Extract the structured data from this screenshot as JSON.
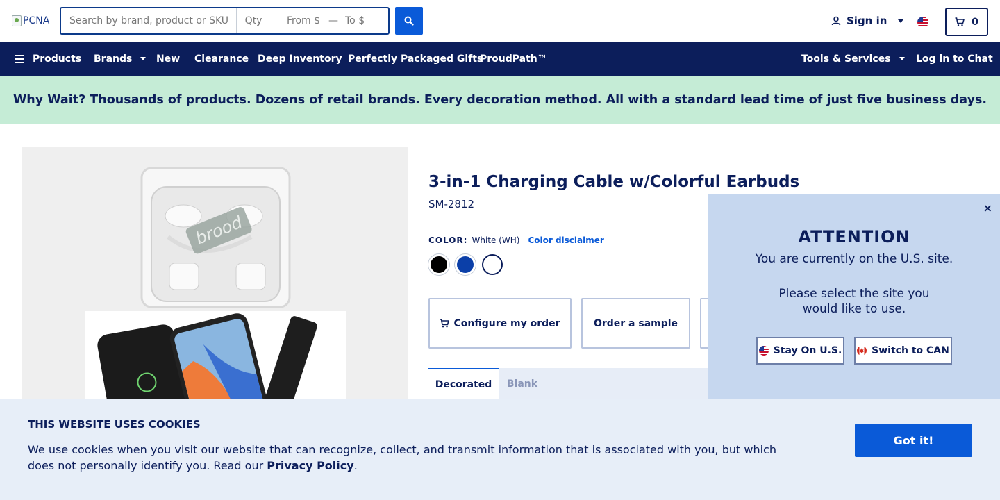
{
  "header": {
    "logo_alt": "PCNA",
    "search": {
      "placeholder": "Search by brand, product or SKU",
      "value": ""
    },
    "qty": {
      "placeholder": "Qty",
      "value": ""
    },
    "price_from": {
      "placeholder": "From $",
      "value": ""
    },
    "price_to": {
      "placeholder": "To $",
      "value": ""
    },
    "price_separator": "—",
    "signin_label": "Sign in",
    "cart_count": "0"
  },
  "nav": {
    "products": "Products",
    "brands": "Brands",
    "new": "New",
    "clearance": "Clearance",
    "deep_inventory": "Deep Inventory",
    "gifts": "Perfectly Packaged Gifts",
    "proudpath": "ProudPath™",
    "tools": "Tools & Services",
    "chat": "Log in to Chat"
  },
  "promo": {
    "text": "Why Wait? Thousands of products. Dozens of retail brands. Every decoration method. All with a standard lead time of just five business days."
  },
  "product": {
    "title": "3-in-1 Charging Cable w/Colorful Earbuds",
    "sku": "SM-2812",
    "image_logo_text": "brood",
    "color_label": "COLOR:",
    "color_value": "White (WH)",
    "color_disclaimer": "Color disclaimer",
    "swatches": [
      {
        "name": "Black",
        "hex": "#000000"
      },
      {
        "name": "Royal Blue",
        "hex": "#0b3fa8"
      },
      {
        "name": "White",
        "hex": "#ffffff"
      }
    ],
    "actions": {
      "configure": "Configure my order",
      "sample": "Order a sample"
    },
    "tabs": {
      "decorated": "Decorated",
      "blank": "Blank"
    }
  },
  "attention": {
    "close": "×",
    "title": "ATTENTION",
    "message1": "You are currently on the U.S. site.",
    "message2": "Please select the site you would like to use.",
    "stay_label": "Stay On U.S.",
    "switch_label": "Switch to CAN"
  },
  "cookies": {
    "title": "THIS WEBSITE USES COOKIES",
    "text": "We use cookies when you visit our website that can recognize, collect, and transmit information that is associated with you, but which does not personally identify you. Read our ",
    "link": "Privacy Policy",
    "end": ".",
    "button": "Got it!"
  },
  "colors": {
    "navy": "#0c1e5b",
    "accent_blue": "#0a5ad8",
    "promo_bg": "#c5ecd6",
    "attention_bg": "#c6d7ef",
    "cookie_bg": "#e7eef8"
  }
}
